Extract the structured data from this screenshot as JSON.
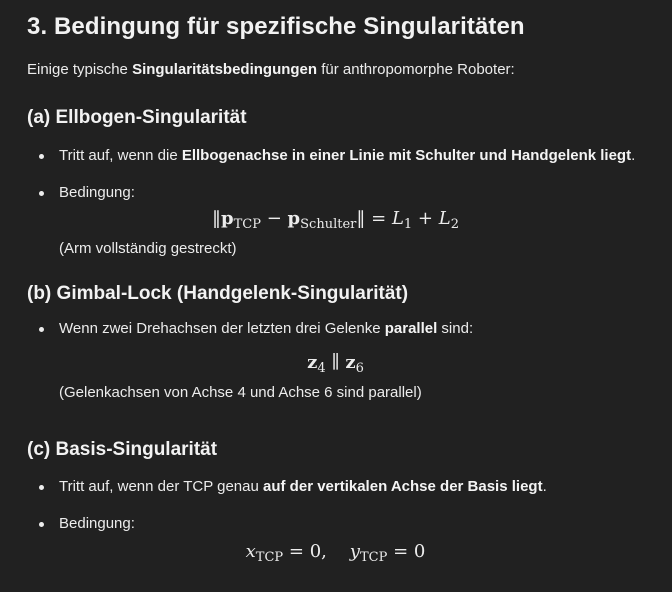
{
  "title": "3. Bedingung für spezifische Singularitäten",
  "intro": {
    "before": "Einige typische ",
    "bold": "Singularitätsbedingungen",
    "after": " für anthropomorphe Roboter:"
  },
  "section_a": {
    "heading": "(a) Ellbogen-Singularität",
    "bullet1_before": "Tritt auf, wenn die ",
    "bullet1_bold": "Ellbogenachse in einer Linie mit Schulter und Handgelenk liegt",
    "bullet1_after": ".",
    "bullet2": "Bedingung:",
    "formula": {
      "p": "p",
      "sub_tcp": "TCP",
      "minus": "−",
      "sub_schulter": "Schulter",
      "eq": "=",
      "L": "L",
      "one": "1",
      "plus": "+",
      "two": "2"
    },
    "note": "(Arm vollständig gestreckt)"
  },
  "section_b": {
    "heading": "(b) Gimbal-Lock (Handgelenk-Singularität)",
    "bullet1_before": "Wenn zwei Drehachsen der letzten drei Gelenke ",
    "bullet1_bold": "parallel",
    "bullet1_after": " sind:",
    "formula": {
      "z": "z",
      "four": "4",
      "par": "∥",
      "six": "6"
    },
    "note": "(Gelenkachsen von Achse 4 und Achse 6 sind parallel)"
  },
  "section_c": {
    "heading": "(c) Basis-Singularität",
    "bullet1_before": "Tritt auf, wenn der TCP genau ",
    "bullet1_bold": "auf der vertikalen Achse der Basis liegt",
    "bullet1_after": ".",
    "bullet2": "Bedingung:",
    "formula": {
      "x": "x",
      "y": "y",
      "sub": "TCP",
      "eq": "=",
      "zero": "0",
      "comma": ","
    }
  }
}
